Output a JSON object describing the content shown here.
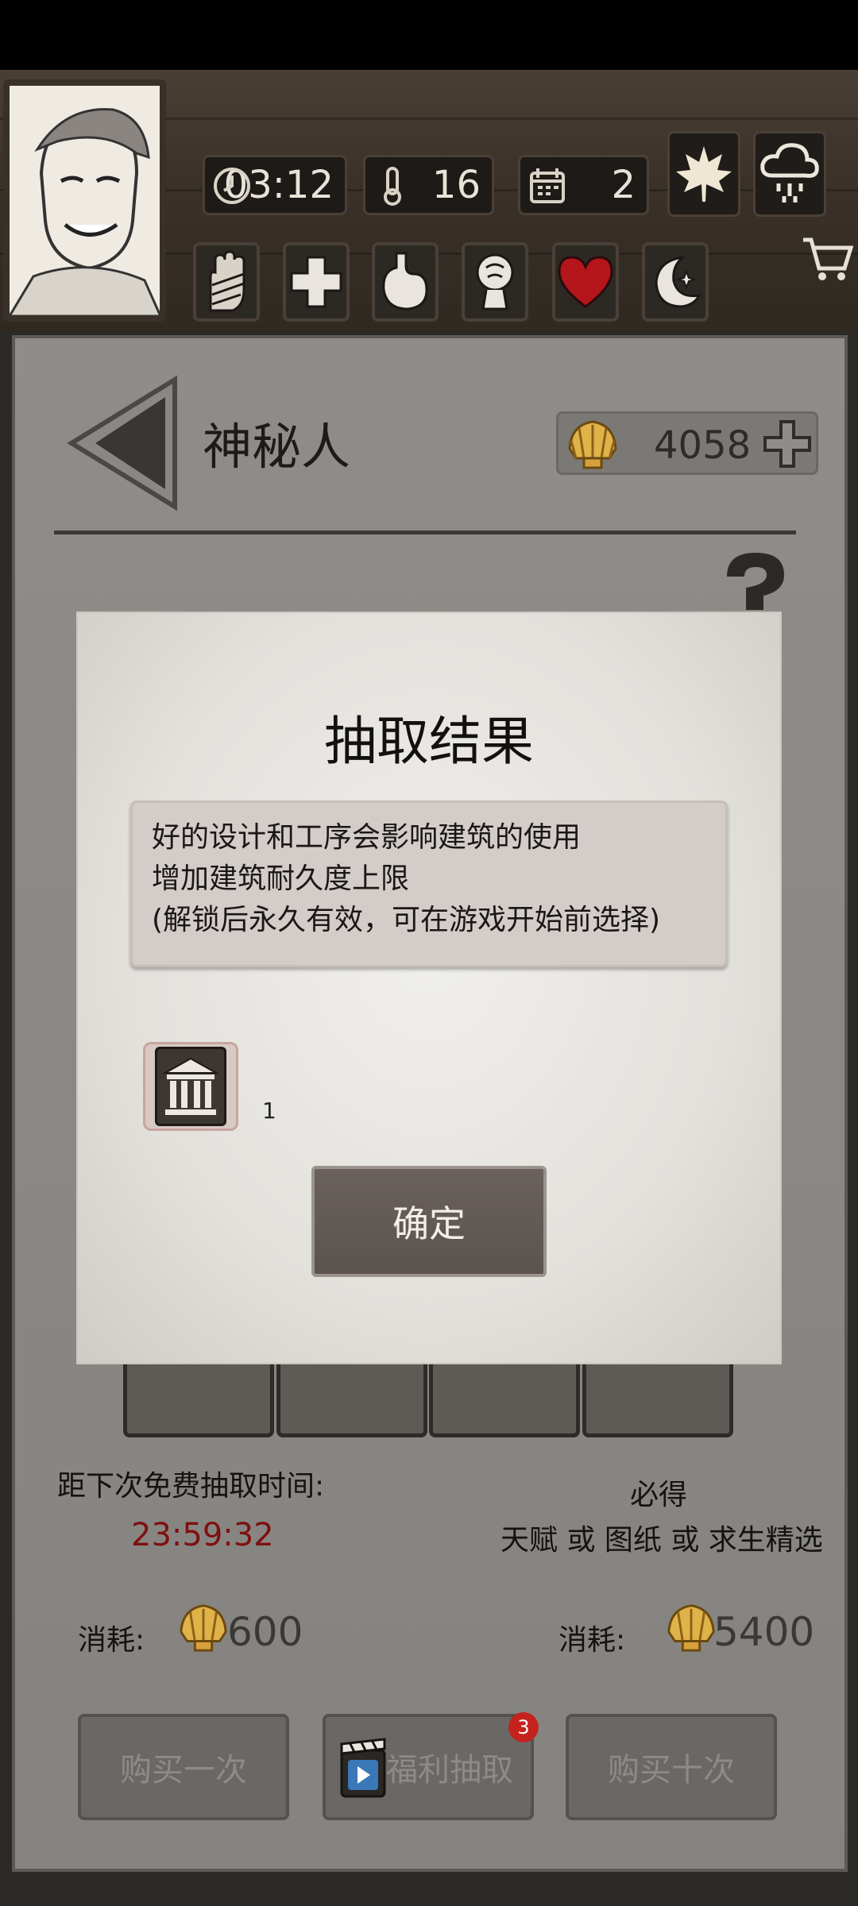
{
  "hud": {
    "time": "03:12",
    "temperature": "16",
    "day": "2"
  },
  "page": {
    "title": "神秘人",
    "shells": "4058"
  },
  "modal": {
    "title": "抽取结果",
    "description": [
      "好的设计和工序会影响建筑的使用",
      "增加建筑耐久度上限",
      "(解锁后永久有效，可在游戏开始前选择)"
    ],
    "item_count": "1",
    "confirm_label": "确定"
  },
  "draw": {
    "free_label": "距下次免费抽取时间:",
    "free_timer": "23:59:32",
    "guarantee_label": "必得",
    "guarantee_items": "天赋 或 图纸 或 求生精选",
    "cost_label": "消耗:",
    "cost_single": "600",
    "cost_ten": "5400"
  },
  "buttons": {
    "buy_once": "购买一次",
    "welfare": "福利抽取",
    "welfare_badge": "3",
    "buy_ten": "购买十次"
  },
  "colors": {
    "timer_red": "#7e1010",
    "badge_red": "#c4231d",
    "heart_red": "#b4161b"
  }
}
